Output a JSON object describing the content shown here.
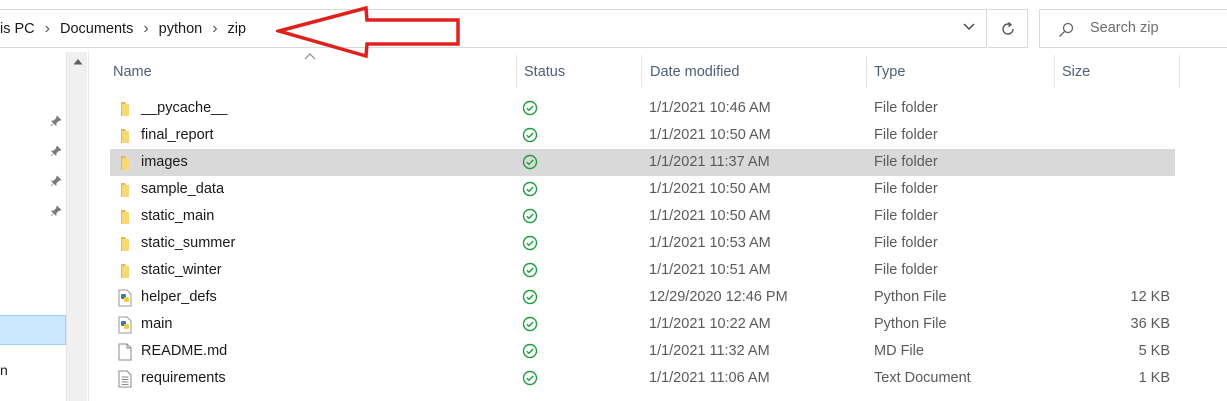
{
  "breadcrumbs": [
    "is PC",
    "Documents",
    "python",
    "zip"
  ],
  "search_placeholder": "Search zip",
  "columns": {
    "name": "Name",
    "status": "Status",
    "date": "Date modified",
    "type": "Type",
    "size": "Size"
  },
  "files": [
    {
      "name": "__pycache__",
      "date": "1/1/2021 10:46 AM",
      "type": "File folder",
      "size": "",
      "icon": "folder-icon"
    },
    {
      "name": "final_report",
      "date": "1/1/2021 10:50 AM",
      "type": "File folder",
      "size": "",
      "icon": "folder-icon"
    },
    {
      "name": "images",
      "date": "1/1/2021 11:37 AM",
      "type": "File folder",
      "size": "",
      "icon": "folder-icon",
      "selected": true
    },
    {
      "name": "sample_data",
      "date": "1/1/2021 10:50 AM",
      "type": "File folder",
      "size": "",
      "icon": "folder-icon"
    },
    {
      "name": "static_main",
      "date": "1/1/2021 10:50 AM",
      "type": "File folder",
      "size": "",
      "icon": "folder-icon"
    },
    {
      "name": "static_summer",
      "date": "1/1/2021 10:53 AM",
      "type": "File folder",
      "size": "",
      "icon": "folder-icon"
    },
    {
      "name": "static_winter",
      "date": "1/1/2021 10:51 AM",
      "type": "File folder",
      "size": "",
      "icon": "folder-icon"
    },
    {
      "name": "helper_defs",
      "date": "12/29/2020 12:46 PM",
      "type": "Python File",
      "size": "12 KB",
      "icon": "python-file-icon"
    },
    {
      "name": "main",
      "date": "1/1/2021 10:22 AM",
      "type": "Python File",
      "size": "36 KB",
      "icon": "python-file-icon"
    },
    {
      "name": "README.md",
      "date": "1/1/2021 11:32 AM",
      "type": "MD File",
      "size": "5 KB",
      "icon": "blank-file-icon"
    },
    {
      "name": "requirements",
      "date": "1/1/2021 11:06 AM",
      "type": "Text Document",
      "size": "1 KB",
      "icon": "text-file-icon"
    }
  ],
  "nav_tail_text": "n",
  "colors": {
    "accent_selected": "#cce8ff",
    "row_selected": "#d9d9d9",
    "status_green": "#1e9e3a",
    "annotation_red": "#e0201c",
    "folder_yellow": "#f8d775"
  }
}
